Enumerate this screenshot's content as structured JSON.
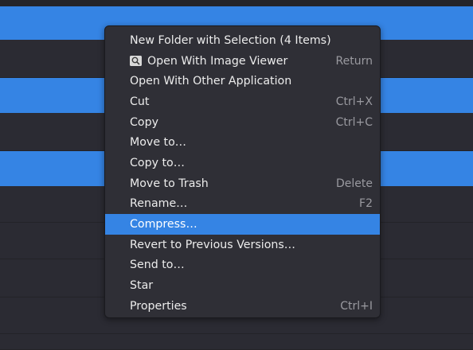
{
  "menu": {
    "items": [
      {
        "label": "New Folder with Selection (4 Items)",
        "accel": ""
      },
      {
        "label": "Open With Image Viewer",
        "accel": "Return",
        "icon": "image-viewer-icon"
      },
      {
        "label": "Open With Other Application",
        "accel": ""
      },
      {
        "label": "Cut",
        "accel": "Ctrl+X"
      },
      {
        "label": "Copy",
        "accel": "Ctrl+C"
      },
      {
        "label": "Move to…",
        "accel": ""
      },
      {
        "label": "Copy to…",
        "accel": ""
      },
      {
        "label": "Move to Trash",
        "accel": "Delete"
      },
      {
        "label": "Rename…",
        "accel": "F2"
      },
      {
        "label": "Compress…",
        "accel": "",
        "highlighted": true
      },
      {
        "label": "Revert to Previous Versions…",
        "accel": ""
      },
      {
        "label": "Send to…",
        "accel": ""
      },
      {
        "label": "Star",
        "accel": ""
      },
      {
        "label": "Properties",
        "accel": "Ctrl+I"
      }
    ]
  },
  "colors": {
    "accent": "#3584e4",
    "menu_bg": "#2f2f36",
    "window_bg": "#2b2b33",
    "text": "#ececec",
    "accel_text": "#9a9aa0"
  }
}
